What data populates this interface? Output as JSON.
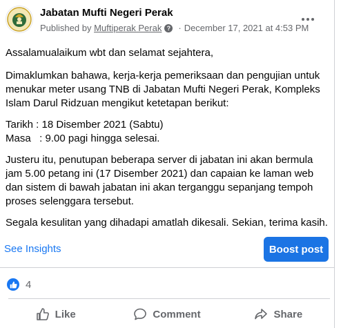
{
  "post": {
    "author": "Jabatan Mufti Negeri Perak",
    "published_prefix": "Published by",
    "publisher": "Muftiperak Perak",
    "separator": "·",
    "date": "December 17, 2021 at 4:53 PM",
    "body": {
      "greeting": "Assalamualaikum wbt dan selamat sejahtera,",
      "para1": [
        "Dimaklumkan bahawa, kerja-kerja pemeriksaan dan pengujian untuk",
        "menukar meter usang TNB di Jabatan Mufti Negeri Perak, Kompleks",
        "Islam Darul Ridzuan mengikut ketetapan berikut:"
      ],
      "tarikh": "Tarikh : 18 Disember 2021 (Sabtu)",
      "masa": "Masa   : 9.00 pagi hingga selesai.",
      "para2": [
        "Justeru itu, penutupan beberapa server di jabatan ini akan bermula",
        "jam 5.00 petang ini (17 Disember 2021) dan capaian ke laman web",
        "dan sistem di bawah jabatan ini akan terganggu sepanjang tempoh",
        "proses selenggara tersebut."
      ],
      "closing": "Segala kesulitan yang dihadapi amatlah dikesali. Sekian, terima kasih."
    }
  },
  "actions": {
    "insights_label": "See Insights",
    "boost_label": "Boost post"
  },
  "reactions": {
    "count": "4"
  },
  "footer": {
    "like_label": "Like",
    "comment_label": "Comment",
    "share_label": "Share"
  },
  "colors": {
    "accent": "#1877f2",
    "boost": "#1b74e4",
    "secondary_text": "#65676b"
  },
  "icons": {
    "more": "more-options-icon",
    "help": "help-icon",
    "like": "thumbs-up-icon",
    "comment": "comment-icon",
    "share": "share-icon"
  }
}
